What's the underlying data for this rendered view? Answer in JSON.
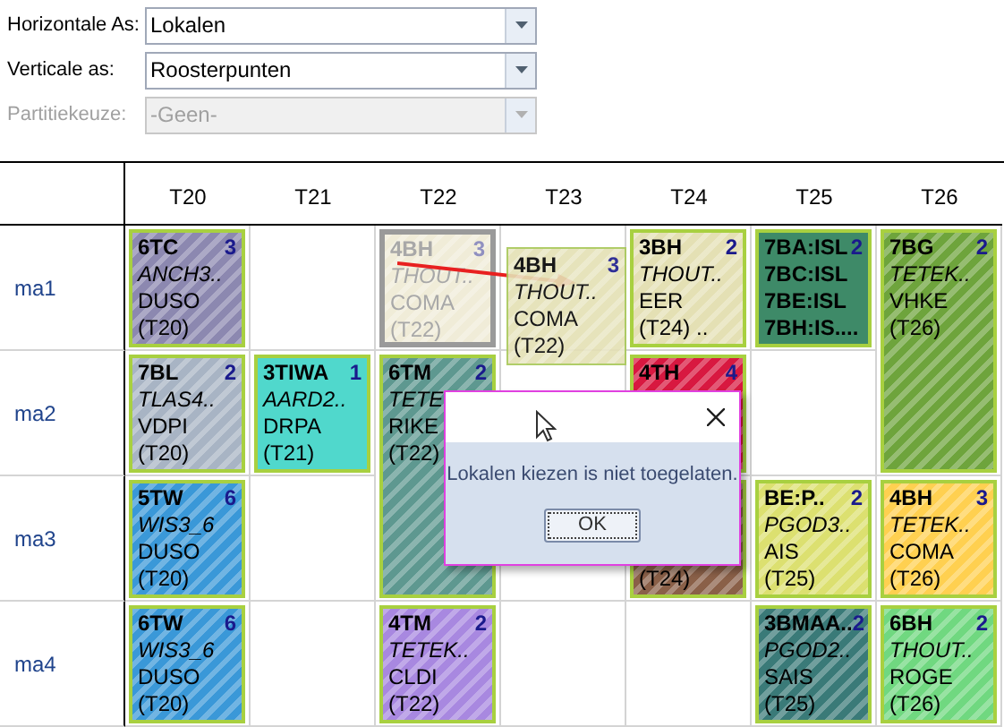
{
  "selectors": [
    {
      "label": "Horizontale As:",
      "value": "Lokalen",
      "disabled": false
    },
    {
      "label": "Verticale as:",
      "value": "Roosterpunten",
      "disabled": false
    },
    {
      "label": "Partitiekeuze:",
      "value": "-Geen-",
      "disabled": true
    }
  ],
  "grid": {
    "columns": [
      "T20",
      "T21",
      "T22",
      "T23",
      "T24",
      "T25",
      "T26"
    ],
    "rows": [
      {
        "label": "ma1",
        "cells": [
          {
            "kind": "lesson",
            "group": "6TC",
            "count": "3",
            "subject": "ANCH3..",
            "teacher": "DUSO",
            "room": "(T20)",
            "color": "#8c88b0",
            "hatched": true,
            "ghost": false
          },
          null,
          {
            "kind": "lesson",
            "group": "4BH",
            "count": "3",
            "subject": "THOUT..",
            "teacher": "COMA",
            "room": "(T22)",
            "color": "#f0ecd8",
            "hatched": true,
            "ghost": true
          },
          null,
          {
            "kind": "lesson",
            "group": "3BH",
            "count": "2",
            "subject": "THOUT..",
            "teacher": "EER",
            "room": "(T24) ..",
            "color": "#e4e0b4",
            "hatched": true,
            "ghost": false
          },
          {
            "kind": "groups",
            "groups": [
              "7BA:ISL",
              "7BC:ISL",
              "7BE:ISL",
              "7BH:IS...."
            ],
            "count": "2",
            "color": "#3e8a68",
            "hatched": false,
            "ghost": false
          },
          {
            "kind": "lesson",
            "group": "7BG",
            "count": "2",
            "subject": "TETEK..",
            "teacher": "VHKE",
            "room": "(T26)",
            "color": "#6ea43c",
            "hatched": true,
            "ghost": false,
            "tall": true
          }
        ]
      },
      {
        "label": "ma2",
        "cells": [
          {
            "kind": "lesson",
            "group": "7BL",
            "count": "2",
            "subject": "TLAS4..",
            "teacher": "VDPI",
            "room": "(T20)",
            "color": "#a8b4c4",
            "hatched": true,
            "ghost": false
          },
          {
            "kind": "lesson",
            "group": "3TIWA",
            "count": "1",
            "subject": "AARD2..",
            "teacher": "DRPA",
            "room": "(T21)",
            "color": "#50d8cc",
            "hatched": false,
            "ghost": false
          },
          {
            "kind": "lesson",
            "group": "6TM",
            "count": "2",
            "subject": "TETE",
            "teacher": "RIKE",
            "room": "(T22)",
            "color": "#5e9890",
            "hatched": true,
            "ghost": false,
            "tall": true
          },
          null,
          {
            "kind": "lesson",
            "group": "4TH",
            "count": "4",
            "color": "#d81840",
            "hatched": true,
            "ghost": false
          },
          null,
          null
        ]
      },
      {
        "label": "ma3",
        "cells": [
          {
            "kind": "lesson",
            "group": "5TW",
            "count": "6",
            "subject": "WIS3_6",
            "teacher": "DUSO",
            "room": "(T20)",
            "color": "#3a98d8",
            "hatched": true,
            "ghost": false
          },
          null,
          null,
          null,
          {
            "kind": "lesson",
            "room": "(T24)",
            "color": "#8a6048",
            "hatched": true,
            "ghost": false
          },
          {
            "kind": "lesson",
            "group": "BE:P..",
            "count": "2",
            "subject": "PGOD3..",
            "teacher": "AIS",
            "room": "(T25)",
            "color": "#dce070",
            "hatched": true,
            "ghost": false
          },
          {
            "kind": "lesson",
            "group": "4BH",
            "count": "3",
            "subject": "TETEK..",
            "teacher": "COMA",
            "room": "(T26)",
            "color": "#ffd050",
            "hatched": true,
            "ghost": false
          }
        ]
      },
      {
        "label": "ma4",
        "cells": [
          {
            "kind": "lesson",
            "group": "6TW",
            "count": "6",
            "subject": "WIS3_6",
            "teacher": "DUSO",
            "room": "(T20)",
            "color": "#3a98d8",
            "hatched": true,
            "ghost": false
          },
          null,
          {
            "kind": "lesson",
            "group": "4TM",
            "count": "2",
            "subject": "TETEK..",
            "teacher": "CLDI",
            "room": "(T22)",
            "color": "#a888e0",
            "hatched": true,
            "ghost": false
          },
          null,
          null,
          {
            "kind": "lesson",
            "group": "3BMAA..",
            "count": "2",
            "subject": "PGOD2..",
            "teacher": "SAIS",
            "room": "(T25)",
            "color": "#3a7a78",
            "hatched": true,
            "ghost": false
          },
          {
            "kind": "lesson",
            "group": "6BH",
            "count": "2",
            "subject": "THOUT..",
            "teacher": "ROGE",
            "room": "(T26)",
            "color": "#70d880",
            "hatched": true,
            "ghost": false
          }
        ]
      }
    ]
  },
  "dragged": {
    "group": "4BH",
    "count": "3",
    "subject": "THOUT..",
    "teacher": "COMA",
    "room": "(T22)",
    "color": "#e4e0b4"
  },
  "dialog": {
    "message": "Lokalen kiezen is niet toegelaten.",
    "button": "OK"
  }
}
